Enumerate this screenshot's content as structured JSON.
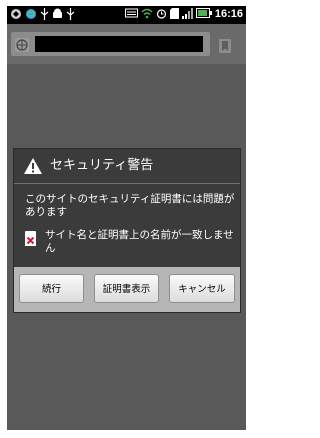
{
  "statusbar": {
    "time": "16:16",
    "icons_left": [
      "app-icon",
      "globe-icon",
      "usb-icon",
      "android-icon",
      "usb-icon"
    ],
    "icons_right": [
      "keyboard-icon",
      "wifi-icon",
      "alarm-icon",
      "sd-icon",
      "signal-icon",
      "battery-icon"
    ]
  },
  "urlbar": {
    "favicon": "globe-icon",
    "bookmark": "bookmark-icon"
  },
  "dialog": {
    "title": "セキュリティ警告",
    "message": "このサイトのセキュリティ証明書には問題があります",
    "error": "サイト名と証明書上の名前が一致しません",
    "buttons": {
      "continue": "続行",
      "view_cert": "証明書表示",
      "cancel": "キャンセル"
    }
  },
  "colors": {
    "dialog_bg": "#3b3b3b",
    "button_bar": "#b6b6b6",
    "overlay": "#595959"
  }
}
